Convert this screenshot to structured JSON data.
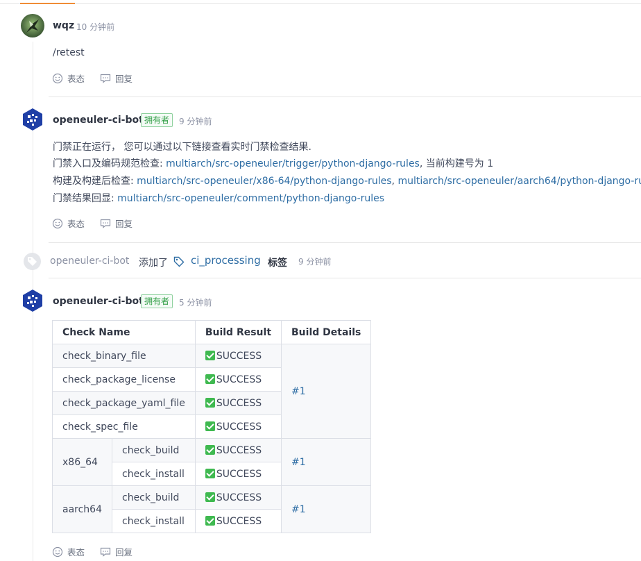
{
  "colors": {
    "accent": "#f08c36",
    "link": "#2e6da4",
    "owner_badge": "#2f9e44",
    "success": "#3fb950"
  },
  "comments": [
    {
      "username": "wqz",
      "time": "10 分钟前",
      "body": "/retest",
      "actions": {
        "react": "表态",
        "reply": "回复"
      }
    },
    {
      "username": "openeuler-ci-bot",
      "badge": "拥有者",
      "time": "9 分钟前",
      "lines": {
        "line1": "门禁正在运行， 您可以通过以下链接查看实时门禁检查结果.",
        "line2_prefix": "门禁入口及编码规范检查: ",
        "line2_link": "multiarch/src-openeuler/trigger/python-django-rules",
        "line2_suffix": ", 当前构建号为 1",
        "line3_prefix": "构建及构建后检查: ",
        "line3_link1": "multiarch/src-openeuler/x86-64/python-django-rules",
        "line3_sep": ", ",
        "line3_link2": "multiarch/src-openeuler/aarch64/python-django-ru",
        "line4_prefix": "门禁结果回显: ",
        "line4_link": "multiarch/src-openeuler/comment/python-django-rules"
      },
      "actions": {
        "react": "表态",
        "reply": "回复"
      }
    },
    {
      "username": "openeuler-ci-bot",
      "badge": "拥有者",
      "time": "5 分钟前",
      "table": {
        "headers": [
          "Check Name",
          "Build Result",
          "Build Details"
        ],
        "rows": [
          {
            "name": "check_binary_file",
            "result": "SUCCESS"
          },
          {
            "name": "check_package_license",
            "result": "SUCCESS"
          },
          {
            "name": "check_package_yaml_file",
            "result": "SUCCESS"
          },
          {
            "name": "check_spec_file",
            "result": "SUCCESS"
          }
        ],
        "details_1": "#1",
        "x86": {
          "arch": "x86_64",
          "build": "check_build",
          "install": "check_install",
          "build_result": "SUCCESS",
          "install_result": "SUCCESS",
          "details": "#1"
        },
        "aarch": {
          "arch": "aarch64",
          "build": "check_build",
          "install": "check_install",
          "build_result": "SUCCESS",
          "install_result": "SUCCESS",
          "details": "#1"
        }
      },
      "actions": {
        "react": "表态",
        "reply": "回复"
      }
    }
  ],
  "label_event": {
    "user": "openeuler-ci-bot",
    "verb": "添加了",
    "tag": "ci_processing",
    "tag_word": "标签",
    "time": "9 分钟前"
  }
}
